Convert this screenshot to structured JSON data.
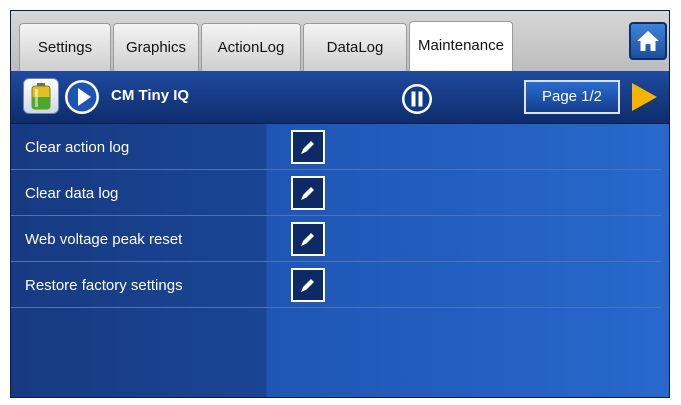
{
  "tabs": [
    {
      "label": "Settings",
      "active": false
    },
    {
      "label": "Graphics",
      "active": false
    },
    {
      "label": "ActionLog",
      "active": false
    },
    {
      "label": "DataLog",
      "active": false
    },
    {
      "label": "Maintenance",
      "active": true
    }
  ],
  "header": {
    "device_name": "CM Tiny IQ",
    "page_label": "Page 1/2"
  },
  "maintenance_items": [
    {
      "label": "Clear action log",
      "icon": "edit-icon"
    },
    {
      "label": "Clear data log",
      "icon": "edit-icon"
    },
    {
      "label": "Web voltage peak reset",
      "icon": "edit-icon"
    },
    {
      "label": "Restore factory settings",
      "icon": "edit-icon"
    }
  ],
  "icons": {
    "home": "home-icon",
    "system": "battery-icon",
    "run": "play-icon",
    "pause": "pause-icon",
    "next": "arrow-right-icon"
  },
  "colors": {
    "background": "#1c3a78",
    "accent": "#f5b400",
    "button": "#2a6bd0"
  }
}
